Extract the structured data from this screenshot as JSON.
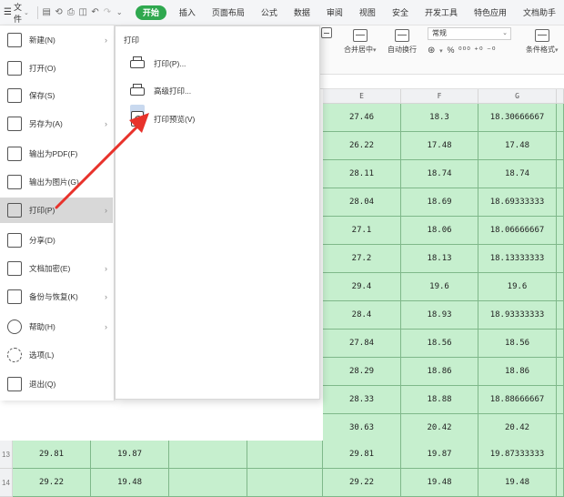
{
  "menubar": {
    "file_label": "文件",
    "tabs": [
      "开始",
      "插入",
      "页面布局",
      "公式",
      "数据",
      "审阅",
      "视图",
      "安全",
      "开发工具",
      "特色应用",
      "文档助手"
    ],
    "active_tab": "开始"
  },
  "ribbon": {
    "merge_label": "合并居中",
    "wrap_label": "自动换行",
    "number_format": "常规",
    "number_buttons": "% ⁰⁰⁰ ⁺⁰ ⁻⁰",
    "conditional_label": "条件格式"
  },
  "file_menu": {
    "items": [
      {
        "label": "新建(N)",
        "icon": "new-file-icon",
        "has_submenu": true
      },
      {
        "label": "打开(O)",
        "icon": "folder-open-icon",
        "has_submenu": false
      },
      {
        "label": "保存(S)",
        "icon": "save-icon",
        "has_submenu": false
      },
      {
        "label": "另存为(A)",
        "icon": "save-as-icon",
        "has_submenu": true
      },
      {
        "label": "输出为PDF(F)",
        "icon": "pdf-icon",
        "has_submenu": false
      },
      {
        "label": "输出为图片(G)",
        "icon": "image-icon",
        "has_submenu": false
      },
      {
        "label": "打印(P)",
        "icon": "printer-icon",
        "has_submenu": true,
        "active": true
      },
      {
        "label": "分享(D)",
        "icon": "share-icon",
        "has_submenu": false
      },
      {
        "label": "文档加密(E)",
        "icon": "lock-document-icon",
        "has_submenu": true
      },
      {
        "label": "备份与恢复(K)",
        "icon": "backup-icon",
        "has_submenu": true
      },
      {
        "label": "帮助(H)",
        "icon": "help-icon",
        "has_submenu": true
      },
      {
        "label": "选项(L)",
        "icon": "gear-icon",
        "has_submenu": false
      },
      {
        "label": "退出(Q)",
        "icon": "exit-icon",
        "has_submenu": false
      }
    ]
  },
  "print_submenu": {
    "title": "打印",
    "items": [
      {
        "label": "打印(P)...",
        "icon": "printer-icon"
      },
      {
        "label": "高级打印...",
        "icon": "advanced-print-icon"
      },
      {
        "label": "打印预览(V)",
        "icon": "print-preview-icon"
      }
    ]
  },
  "sheet": {
    "columns": [
      "E",
      "F",
      "G"
    ],
    "rows": [
      [
        "27.46",
        "18.3",
        "18.30666667"
      ],
      [
        "26.22",
        "17.48",
        "17.48"
      ],
      [
        "28.11",
        "18.74",
        "18.74"
      ],
      [
        "28.04",
        "18.69",
        "18.69333333"
      ],
      [
        "27.1",
        "18.06",
        "18.06666667"
      ],
      [
        "27.2",
        "18.13",
        "18.13333333"
      ],
      [
        "29.4",
        "19.6",
        "19.6"
      ],
      [
        "28.4",
        "18.93",
        "18.93333333"
      ],
      [
        "27.84",
        "18.56",
        "18.56"
      ],
      [
        "28.29",
        "18.86",
        "18.86"
      ],
      [
        "28.33",
        "18.88",
        "18.88666667"
      ],
      [
        "30.63",
        "20.42",
        "20.42"
      ]
    ],
    "bottom_rows": [
      {
        "row_number": "13",
        "cells": [
          "29.81",
          "19.87",
          "",
          "",
          "29.81",
          "19.87",
          "19.87333333"
        ]
      },
      {
        "row_number": "14",
        "cells": [
          "29.22",
          "19.48",
          "",
          "",
          "29.22",
          "19.48",
          "19.48"
        ]
      }
    ]
  },
  "colors": {
    "accent": "#2fa84f",
    "cell_fill": "#c6efce",
    "arrow": "#e8322b",
    "selected_item": "#d8d8d8"
  }
}
